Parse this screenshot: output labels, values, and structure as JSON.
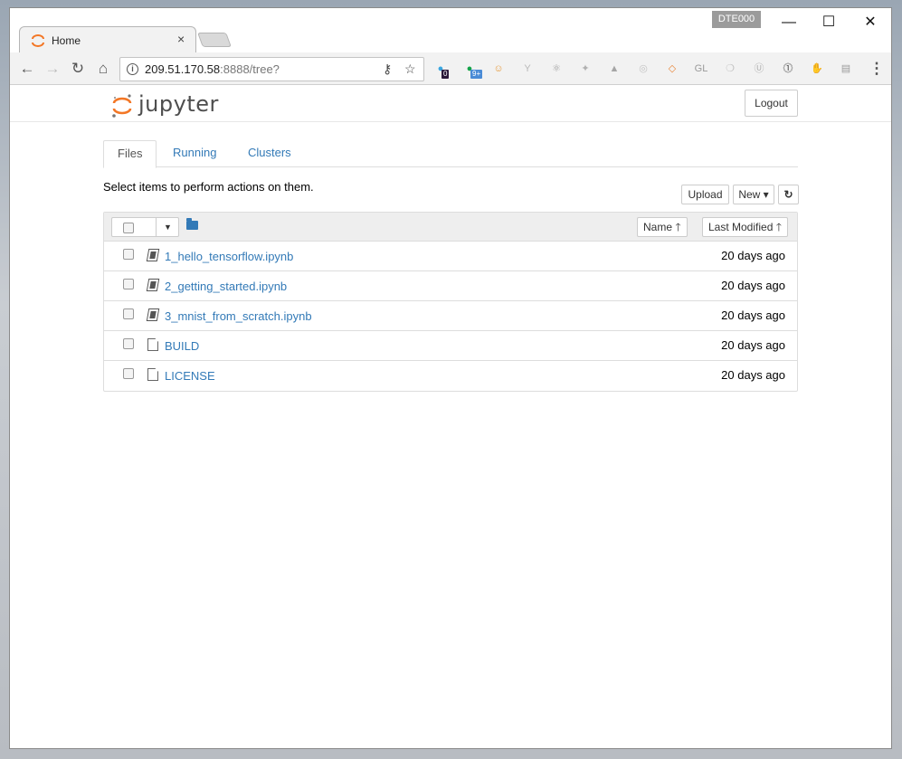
{
  "browser": {
    "profile_badge": "DTE000",
    "tab": {
      "title": "Home",
      "close": "×"
    },
    "window_controls": {
      "minimize": "—",
      "maximize": "☐",
      "close": "✕"
    },
    "nav": {
      "back": "←",
      "forward": "→",
      "reload": "↻",
      "home": "⌂"
    },
    "url": {
      "host": "209.51.170.58",
      "rest": ":8888/tree?"
    },
    "extensions": [
      {
        "name": "ghostery-icon",
        "glyph": "●",
        "color": "#3aa6e0",
        "badge": "0",
        "badge_color": "#2b1a3a"
      },
      {
        "name": "grammarly-icon",
        "glyph": "●",
        "color": "#14a34a",
        "badge": "9+",
        "badge_color": "#4a8bd6"
      },
      {
        "name": "face-extension-icon",
        "glyph": "☺",
        "color": "#e69a3c"
      },
      {
        "name": "y-extension-icon",
        "glyph": "Y",
        "color": "#b9b9b9"
      },
      {
        "name": "react-devtools-icon",
        "glyph": "⚛",
        "color": "#a0a0a0"
      },
      {
        "name": "puzzle-extension-icon",
        "glyph": "✦",
        "color": "#b0b0b0"
      },
      {
        "name": "drive-icon",
        "glyph": "▲",
        "color": "#a5a5a5"
      },
      {
        "name": "target-extension-icon",
        "glyph": "◎",
        "color": "#c4c4c4"
      },
      {
        "name": "code-extension-icon",
        "glyph": "◇",
        "color": "#e8863a"
      },
      {
        "name": "gl-extension-icon",
        "glyph": "GL",
        "color": "#9a9a9a"
      },
      {
        "name": "leaf-extension-icon",
        "glyph": "❍",
        "color": "#c0c0c0"
      },
      {
        "name": "u-extension-icon",
        "glyph": "Ⓤ",
        "color": "#b0b0b0"
      },
      {
        "name": "1password-icon",
        "glyph": "⓵",
        "color": "#444444"
      },
      {
        "name": "hand-extension-icon",
        "glyph": "✋",
        "color": "#777777"
      },
      {
        "name": "page-extension-icon",
        "glyph": "▤",
        "color": "#9a9a9a"
      }
    ],
    "menu": "⋮"
  },
  "jupyter": {
    "logo_text": "jupyter",
    "logout_label": "Logout",
    "tabs": [
      {
        "label": "Files",
        "active": true
      },
      {
        "label": "Running",
        "active": false
      },
      {
        "label": "Clusters",
        "active": false
      }
    ],
    "hint": "Select items to perform actions on them.",
    "upload_label": "Upload",
    "new_label": "New ▾",
    "refresh_label": "↻",
    "sort_name_label": "Name 🡑",
    "sort_modified_label": "Last Modified 🡑",
    "files": [
      {
        "name": "1_hello_tensorflow.ipynb",
        "modified": "20 days ago",
        "kind": "notebook"
      },
      {
        "name": "2_getting_started.ipynb",
        "modified": "20 days ago",
        "kind": "notebook"
      },
      {
        "name": "3_mnist_from_scratch.ipynb",
        "modified": "20 days ago",
        "kind": "notebook"
      },
      {
        "name": "BUILD",
        "modified": "20 days ago",
        "kind": "file"
      },
      {
        "name": "LICENSE",
        "modified": "20 days ago",
        "kind": "file"
      }
    ]
  },
  "colors": {
    "link": "#337ab7",
    "jupyter_orange": "#f37726"
  }
}
